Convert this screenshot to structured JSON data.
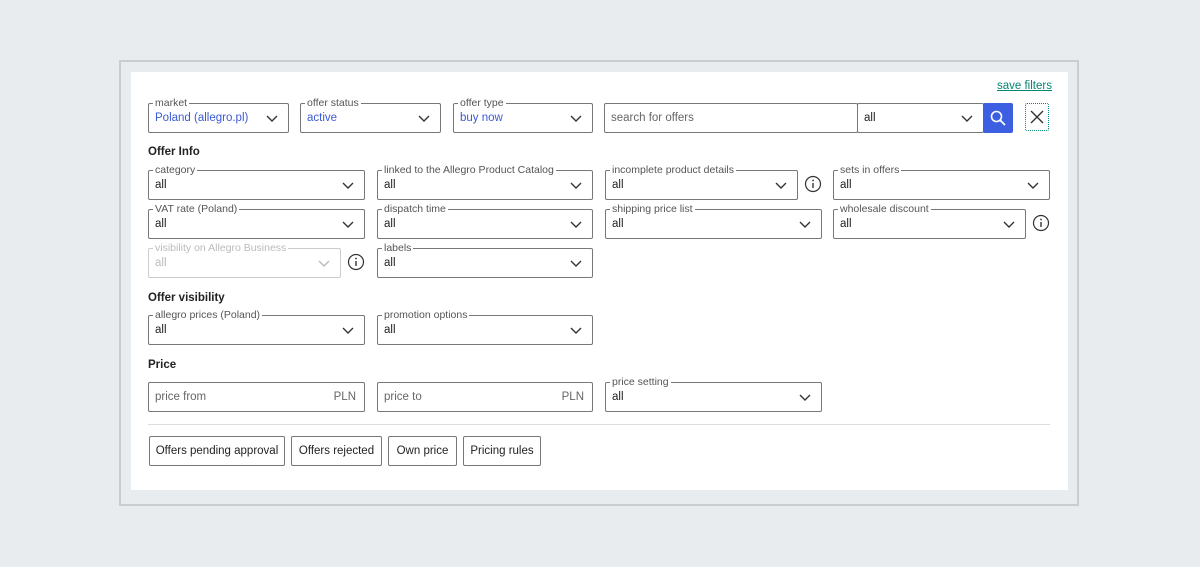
{
  "save_filters": "save filters",
  "top": {
    "market": {
      "label": "market",
      "value": "Poland (allegro.pl)"
    },
    "offer_status": {
      "label": "offer status",
      "value": "active"
    },
    "offer_type": {
      "label": "offer type",
      "value": "buy now"
    },
    "search": {
      "placeholder": "search for offers",
      "scope": "all"
    }
  },
  "offer_info": {
    "title": "Offer Info",
    "category": {
      "label": "category",
      "value": "all"
    },
    "linked_catalog": {
      "label": "linked to the Allegro Product Catalog",
      "value": "all"
    },
    "incomplete_details": {
      "label": "incomplete product details",
      "value": "all"
    },
    "sets_in_offers": {
      "label": "sets in offers",
      "value": "all"
    },
    "vat_rate": {
      "label": "VAT rate (Poland)",
      "value": "all"
    },
    "dispatch_time": {
      "label": "dispatch time",
      "value": "all"
    },
    "shipping_price_list": {
      "label": "shipping price list",
      "value": "all"
    },
    "wholesale_discount": {
      "label": "wholesale discount",
      "value": "all"
    },
    "visibility_business": {
      "label": "visibility on Allegro Business",
      "value": "all"
    },
    "labels": {
      "label": "labels",
      "value": "all"
    }
  },
  "offer_visibility": {
    "title": "Offer visibility",
    "allegro_prices": {
      "label": "allegro prices (Poland)",
      "value": "all"
    },
    "promotion_options": {
      "label": "promotion options",
      "value": "all"
    }
  },
  "price": {
    "title": "Price",
    "price_from": {
      "placeholder": "price from",
      "currency": "PLN"
    },
    "price_to": {
      "placeholder": "price to",
      "currency": "PLN"
    },
    "price_setting": {
      "label": "price setting",
      "value": "all"
    }
  },
  "buttons": {
    "pending": "Offers pending approval",
    "rejected": "Offers rejected",
    "own_price": "Own price",
    "pricing_rules": "Pricing rules"
  },
  "colors": {
    "accent": "#3b5fe0",
    "link": "#008673",
    "value_blue": "#3b5ad6"
  }
}
